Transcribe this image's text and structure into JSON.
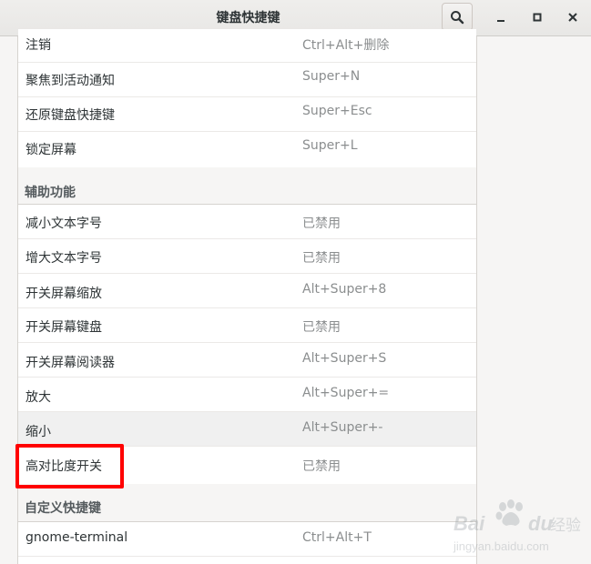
{
  "window": {
    "title": "键盘快捷键"
  },
  "list": {
    "rows_top": [
      {
        "name": "注销",
        "accel": "Ctrl+Alt+删除"
      },
      {
        "name": "聚焦到活动通知",
        "accel": "Super+N"
      },
      {
        "name": "还原键盘快捷键",
        "accel": "Super+Esc"
      },
      {
        "name": "锁定屏幕",
        "accel": "Super+L"
      }
    ],
    "section_accessibility": "辅助功能",
    "rows_accessibility": [
      {
        "name": "减小文本字号",
        "accel": "已禁用"
      },
      {
        "name": "增大文本字号",
        "accel": "已禁用"
      },
      {
        "name": "开关屏幕缩放",
        "accel": "Alt+Super+8"
      },
      {
        "name": "开关屏幕键盘",
        "accel": "已禁用"
      },
      {
        "name": "开关屏幕阅读器",
        "accel": "Alt+Super+S"
      },
      {
        "name": "放大",
        "accel": "Alt+Super+="
      },
      {
        "name": "缩小",
        "accel": "Alt+Super+-"
      },
      {
        "name": "高对比度开关",
        "accel": "已禁用"
      }
    ],
    "section_custom": "自定义快捷键",
    "rows_custom": [
      {
        "name": "gnome-terminal",
        "accel": "Ctrl+Alt+T"
      }
    ]
  },
  "watermark": {
    "brand": "Bai du 经验",
    "url": "jingyan.baidu.com"
  },
  "colors": {
    "highlight": "#ff0000",
    "accel_text": "#8b8e8f",
    "section_text": "#555b5e"
  }
}
